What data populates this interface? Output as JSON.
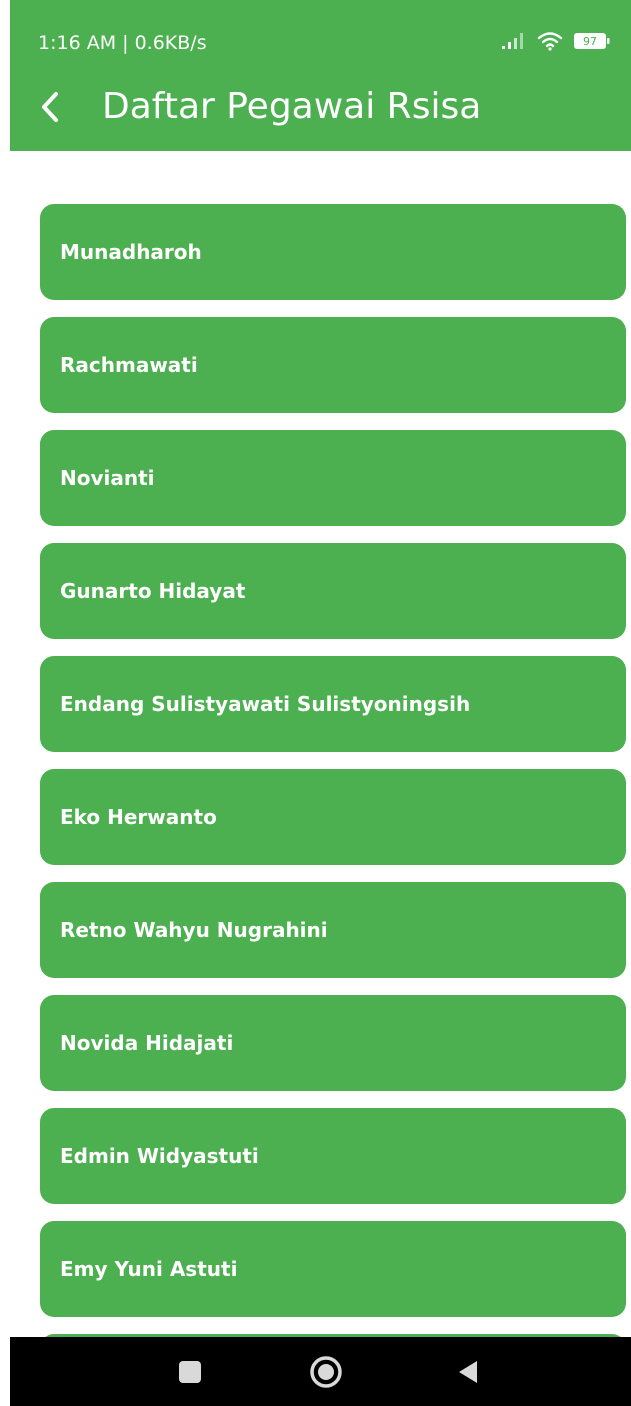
{
  "status_bar": {
    "time": "1:16 AM | 0.6KB/s",
    "battery": "97",
    "icons": [
      "signal-icon",
      "wifi-icon",
      "battery-icon"
    ]
  },
  "app_bar": {
    "title": "Daftar Pegawai Rsisa",
    "back_icon": "chevron-left-icon",
    "color": "#4caf50"
  },
  "employees": [
    {
      "name": "Munadharoh"
    },
    {
      "name": "Rachmawati"
    },
    {
      "name": "Novianti"
    },
    {
      "name": "Gunarto Hidayat"
    },
    {
      "name": "Endang Sulistyawati Sulistyoningsih"
    },
    {
      "name": "Eko Herwanto"
    },
    {
      "name": "Retno Wahyu Nugrahini"
    },
    {
      "name": "Novida Hidajati"
    },
    {
      "name": "Edmin Widyastuti"
    },
    {
      "name": "Emy Yuni Astuti"
    },
    {
      "name": ""
    }
  ],
  "nav_bar": {
    "buttons": [
      "recents-square-icon",
      "home-circle-icon",
      "back-triangle-icon"
    ]
  }
}
